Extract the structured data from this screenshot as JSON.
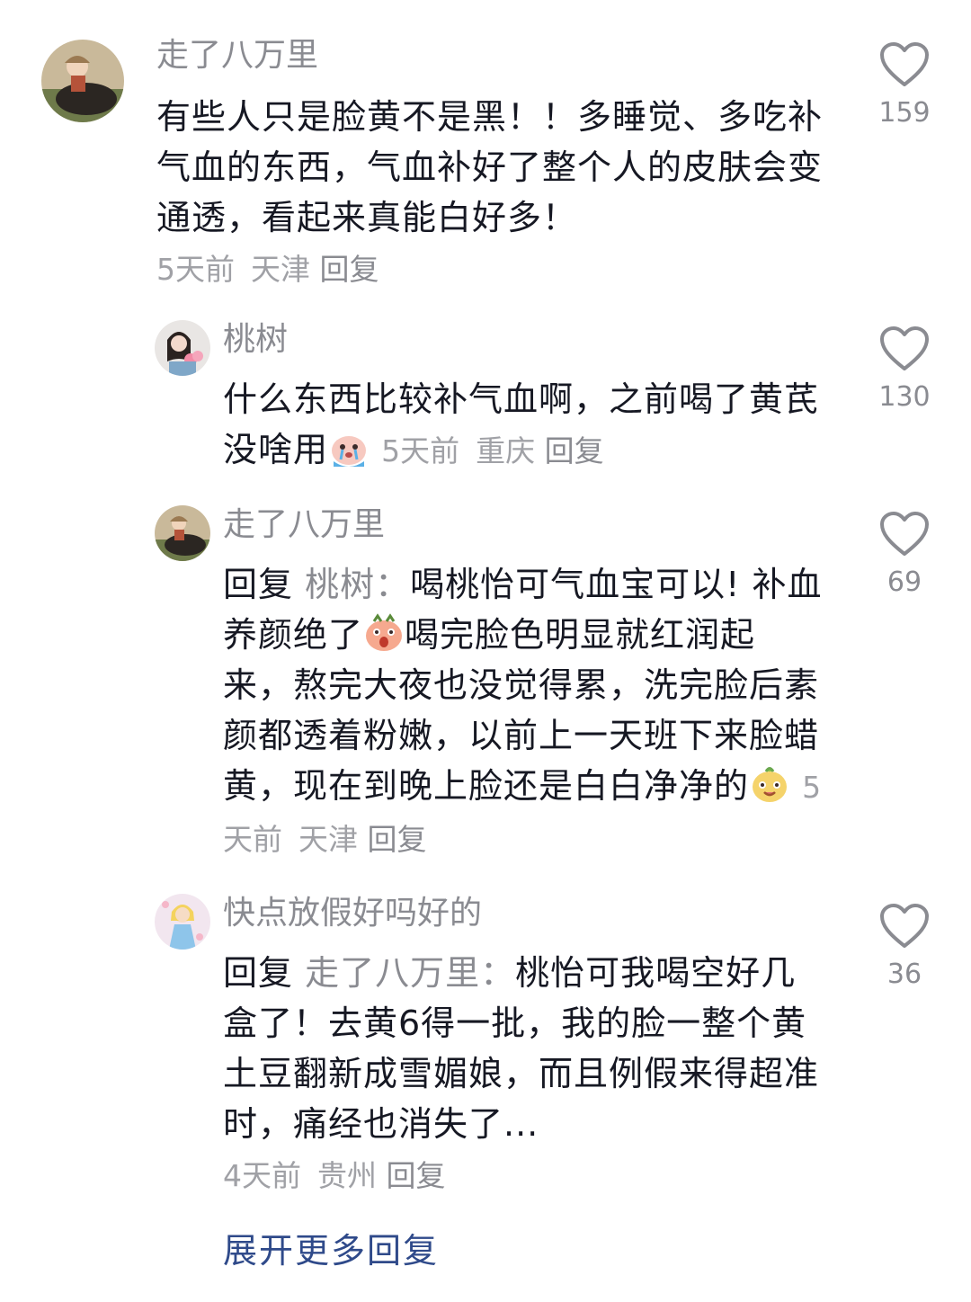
{
  "comments": [
    {
      "username": "走了八万里",
      "text": "有些人只是脸黄不是黑！！多睡觉、多吃补气血的东西，气血补好了整个人的皮肤会变通透，看起来真能白好多！",
      "time": "5天前",
      "location": "天津",
      "reply_label": "回复",
      "likes": "159",
      "avatar_icon": "avatar-girl-on-buffalo"
    },
    {
      "username": "桃树",
      "text": "什么东西比较补气血啊，之前喝了黄芪没啥用",
      "emoji": "crying-face-emoji",
      "time": "5天前",
      "location": "重庆",
      "reply_label": "回复",
      "likes": "130",
      "avatar_icon": "avatar-woman-with-flowers"
    },
    {
      "username": "走了八万里",
      "reply_prefix": "回复",
      "reply_target": "桃树",
      "reply_colon": "：",
      "text_a": "喝桃怡可气血宝可以! 补血养颜绝了",
      "emoji_a": "shocked-face-emoji",
      "text_b": "喝完脸色明显就红润起来，熬完大夜也没觉得累，洗完脸后素颜都透着粉嫩，以前上一天班下来脸蜡黄，现在到晚上脸还是白白净净的",
      "emoji_b": "cute-potato-face-emoji",
      "time": "5天前",
      "location": "天津",
      "reply_label": "回复",
      "likes": "69",
      "avatar_icon": "avatar-girl-on-buffalo"
    },
    {
      "username": "快点放假好吗好的",
      "reply_prefix": "回复",
      "reply_target": "走了八万里",
      "reply_colon": "：",
      "text": "桃怡可我喝空好几盒了！去黄6得一批，我的脸一整个黄土豆翻新成雪媚娘，而且例假来得超准时，痛经也消失了...",
      "time": "4天前",
      "location": "贵州",
      "reply_label": "回复",
      "likes": "36",
      "avatar_icon": "avatar-cartoon-princess"
    }
  ],
  "expand_more": "展开更多回复",
  "colors": {
    "text": "#161823",
    "secondary": "#8a8b91",
    "meta": "#a0a1a6",
    "link": "#2f4a8a"
  }
}
